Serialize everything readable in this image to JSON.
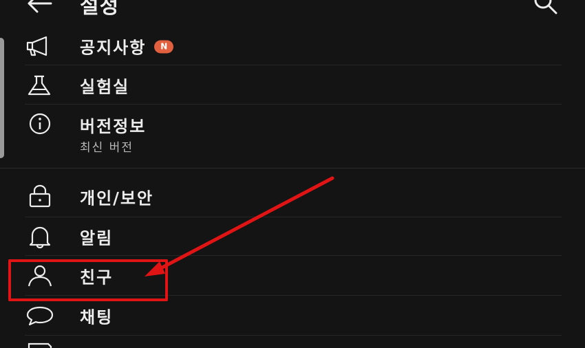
{
  "header": {
    "title": "설정",
    "back_icon": "arrow-left-icon",
    "search_icon": "search-icon"
  },
  "items": [
    {
      "label": "공지사항",
      "icon": "megaphone-icon",
      "badge": "N"
    },
    {
      "label": "실험실",
      "icon": "flask-icon"
    },
    {
      "label": "버전정보",
      "icon": "info-icon",
      "sub": "최신 버전"
    },
    {
      "label": "개인/보안",
      "icon": "lock-icon"
    },
    {
      "label": "알림",
      "icon": "bell-icon"
    },
    {
      "label": "친구",
      "icon": "person-icon"
    },
    {
      "label": "채팅",
      "icon": "chat-bubble-icon"
    }
  ],
  "colors": {
    "background": "#141414",
    "text": "#ededed",
    "badge": "#e0603f",
    "annotation": "#e01414"
  }
}
